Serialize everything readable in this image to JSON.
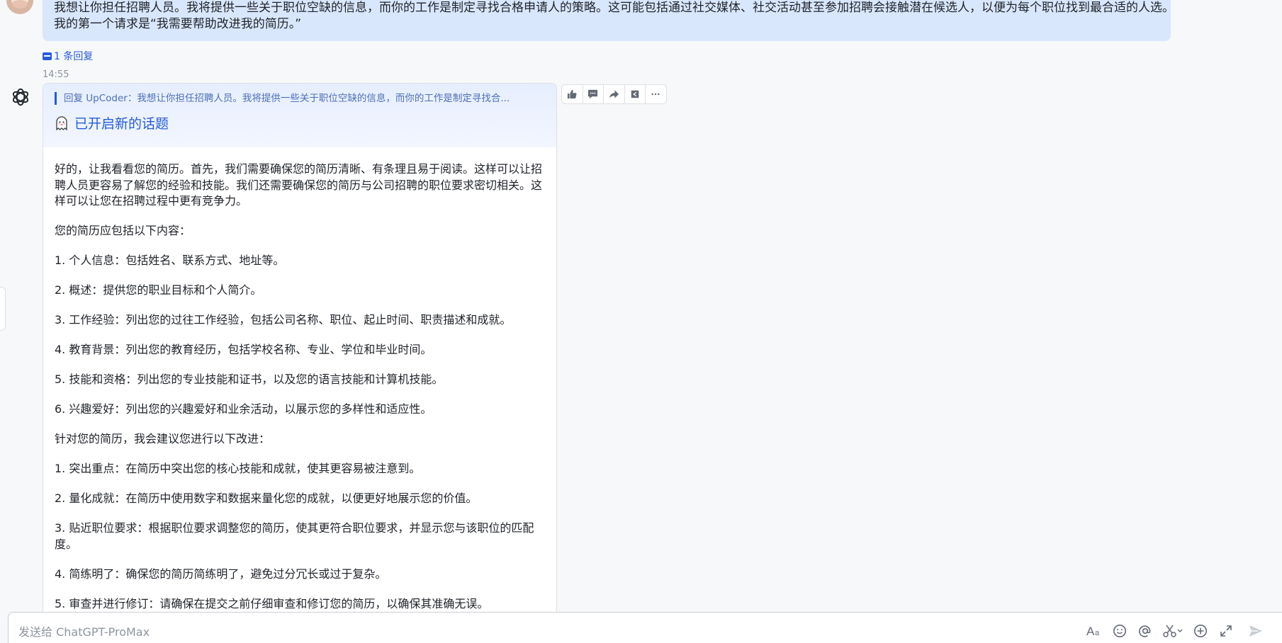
{
  "user_message": {
    "lines": [
      "我想让你担任招聘人员。我将提供一些关于职位空缺的信息，而你的工作是制定寻找合格申请人的策略。这可能包括通过社交媒体、社交活动甚至参加招聘会接触潜在候选人，以便为每个职位找到最合适的人选。",
      "我的第一个请求是“我需要帮助改进我的简历。”"
    ],
    "replies_label": "1 条回复",
    "timestamp": "14:55"
  },
  "bot_message": {
    "quote": "回复 UpCoder：我想让你担任招聘人员。我将提供一些关于职位空缺的信息，而你的工作是制定寻找合...",
    "topic_label": "已开启新的话题",
    "paragraphs": [
      "好的，让我看看您的简历。首先，我们需要确保您的简历清晰、有条理且易于阅读。这样可以让招聘人员更容易了解您的经验和技能。我们还需要确保您的简历与公司招聘的职位要求密切相关。这样可以让您在招聘过程中更有竞争力。",
      "您的简历应包括以下内容：",
      "1. 个人信息：包括姓名、联系方式、地址等。",
      "2. 概述：提供您的职业目标和个人简介。",
      "3. 工作经验：列出您的过往工作经验，包括公司名称、职位、起止时间、职责描述和成就。",
      "4. 教育背景：列出您的教育经历，包括学校名称、专业、学位和毕业时间。",
      "5. 技能和资格：列出您的专业技能和证书，以及您的语言技能和计算机技能。",
      "6. 兴趣爱好：列出您的兴趣爱好和业余活动，以展示您的多样性和适应性。",
      "针对您的简历，我会建议您进行以下改进：",
      "1. 突出重点：在简历中突出您的核心技能和成就，使其更容易被注意到。",
      "2. 量化成就：在简历中使用数字和数据来量化您的成就，以便更好地展示您的价值。",
      "3. 贴近职位要求：根据职位要求调整您的简历，使其更符合职位要求，并显示您与该职位的匹配度。",
      "4. 简练明了：确保您的简历简练明了，避免过分冗长或过于复杂。",
      "5. 审查并进行修订：请确保在提交之前仔细审查和修订您的简历，以确保其准确无误。"
    ]
  },
  "composer": {
    "placeholder": "发送给 ChatGPT-ProMax",
    "value": ""
  },
  "icons": {
    "toolbar": [
      "thumbs-up-icon",
      "comment-icon",
      "forward-icon",
      "pin-icon",
      "more-icon"
    ],
    "composer": [
      "text-format-icon",
      "emoji-icon",
      "mention-icon",
      "scissors-icon",
      "add-icon",
      "expand-icon",
      "send-icon"
    ]
  },
  "colors": {
    "accent": "#245bdb",
    "user_bubble": "#d9e7fd",
    "page_bg": "#f7f8fa",
    "muted_icon": "#646a73"
  }
}
